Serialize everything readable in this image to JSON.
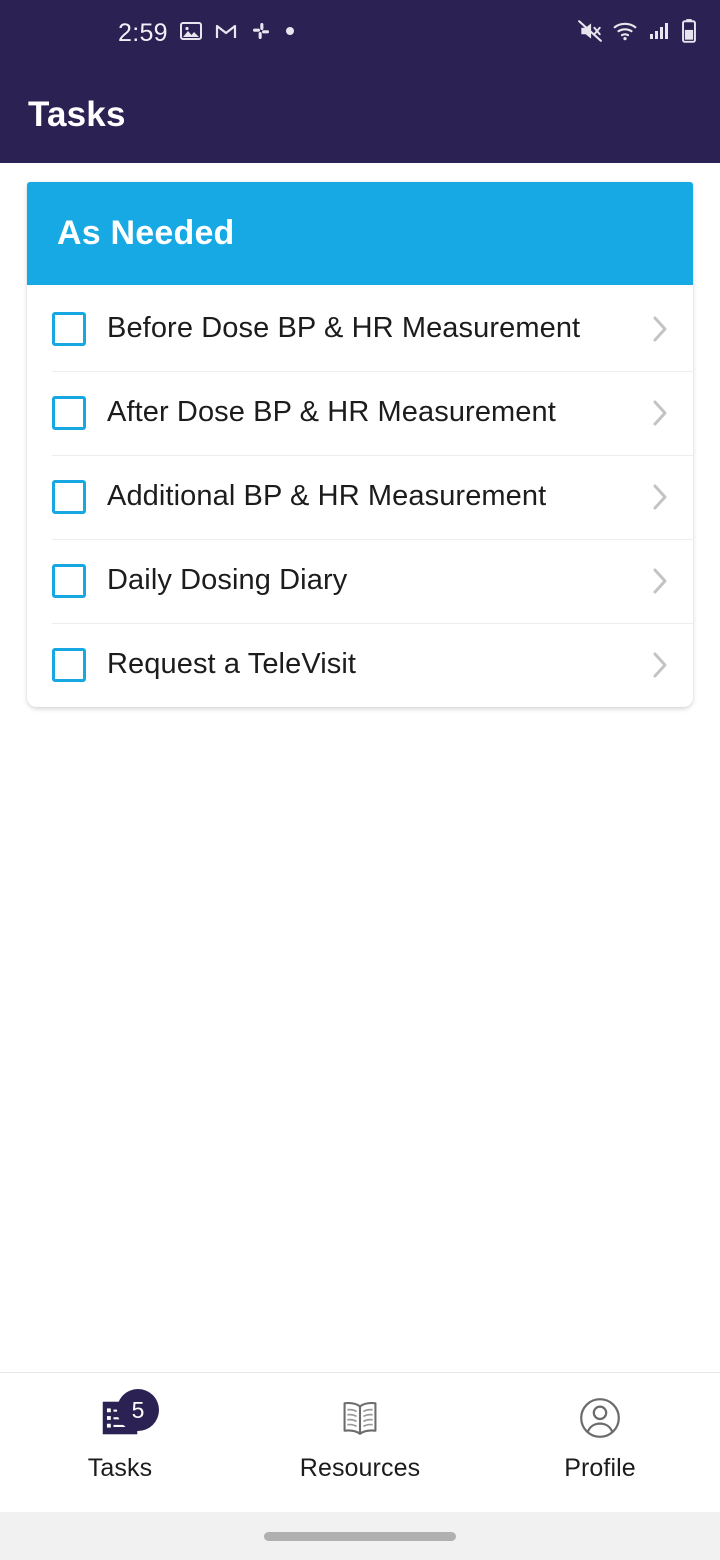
{
  "status_bar": {
    "time": "2:59",
    "left_icons": [
      "photo-icon",
      "gmail-icon",
      "slack-icon",
      "dot-icon"
    ],
    "right_icons": [
      "mute-icon",
      "wifi-icon",
      "signal-icon",
      "battery-icon"
    ],
    "background_color": "#2B2152"
  },
  "app_bar": {
    "title": "Tasks",
    "background_color": "#2B2152",
    "text_color": "#FFFFFF"
  },
  "section": {
    "title": "As Needed",
    "banner_color": "#16A9E4",
    "checkbox_color": "#17A8E3"
  },
  "tasks": [
    {
      "label": "Before Dose BP & HR Measurement",
      "checked": false,
      "chevron": "chevron-right-icon"
    },
    {
      "label": "After Dose BP & HR Measurement",
      "checked": false,
      "chevron": "chevron-right-icon"
    },
    {
      "label": "Additional BP & HR Measurement",
      "checked": false,
      "chevron": "chevron-right-icon"
    },
    {
      "label": "Daily Dosing Diary",
      "checked": false,
      "chevron": "chevron-right-icon"
    },
    {
      "label": "Request a TeleVisit",
      "checked": false,
      "chevron": "chevron-right-icon"
    }
  ],
  "bottom_nav": {
    "items": [
      {
        "label": "Tasks",
        "icon": "task-list-icon",
        "badge": "5",
        "selected": true
      },
      {
        "label": "Resources",
        "icon": "book-icon",
        "badge": "",
        "selected": false
      },
      {
        "label": "Profile",
        "icon": "person-circle-icon",
        "badge": "",
        "selected": false
      }
    ],
    "badge_color": "#2B2152"
  }
}
